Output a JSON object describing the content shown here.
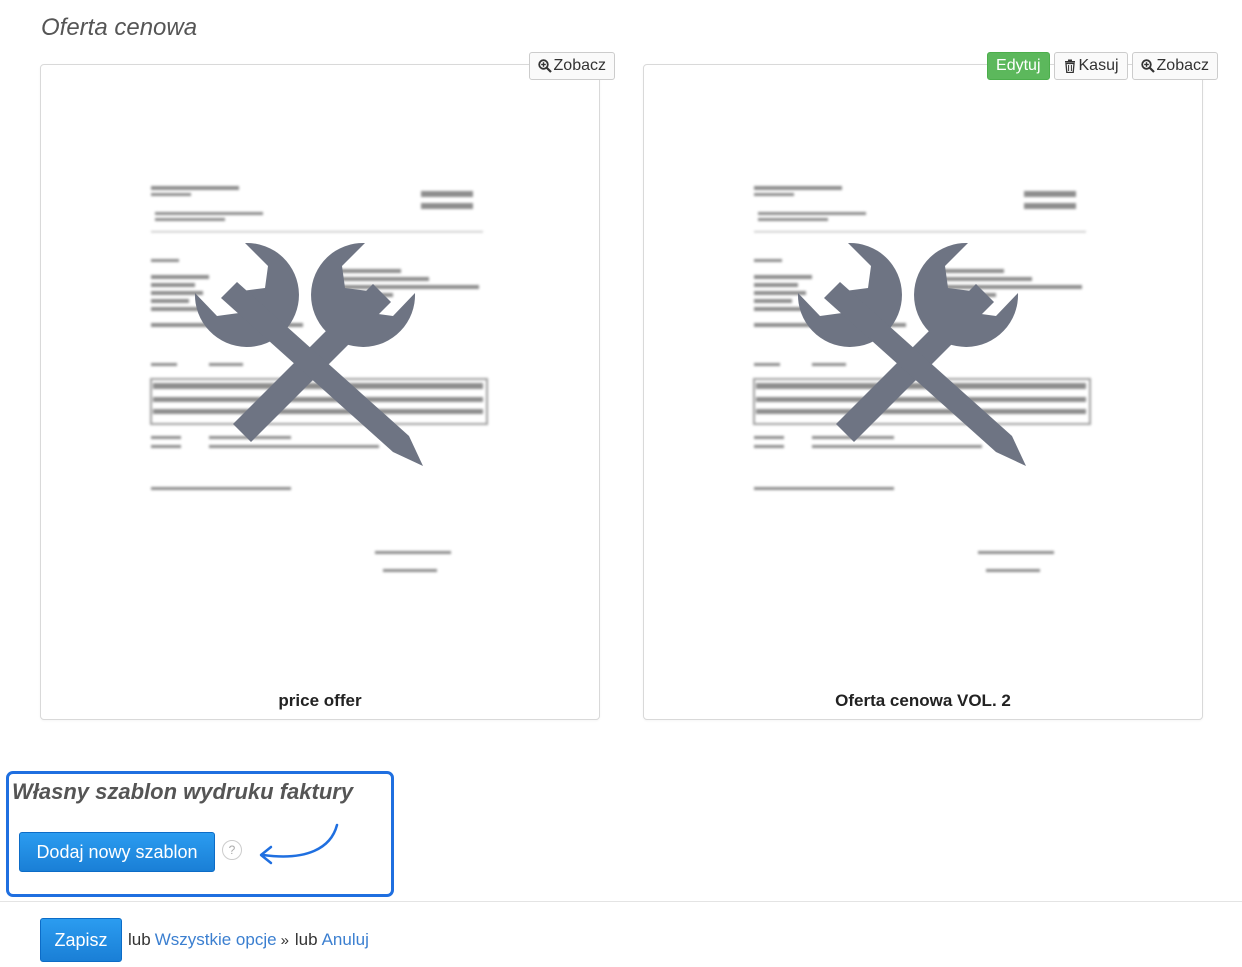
{
  "section": {
    "title": "Oferta cenowa"
  },
  "templates": [
    {
      "label": "price offer",
      "view_label": "Zobacz"
    },
    {
      "label": "Oferta cenowa VOL. 2",
      "edit_label": "Edytuj",
      "delete_label": "Kasuj",
      "view_label": "Zobacz"
    }
  ],
  "custom": {
    "title": "Własny szablon wydruku faktury",
    "add_button": "Dodaj nowy szablon",
    "help": "?"
  },
  "footer": {
    "save": "Zapisz",
    "or1": "lub",
    "all_options": "Wszystkie opcje",
    "raquo": "»",
    "or2": "lub",
    "cancel": "Anuluj"
  },
  "colors": {
    "primary": "#1a7fd6",
    "edit_green": "#5cb85c",
    "highlight": "#1f6fe0",
    "tool_icon": "#6e7483"
  },
  "icons": {
    "view": "magnifier-plus-icon",
    "delete": "trash-icon",
    "preview": "wrench-pencil-icon",
    "help": "question-circle-icon",
    "annotation": "curved-arrow-icon"
  }
}
